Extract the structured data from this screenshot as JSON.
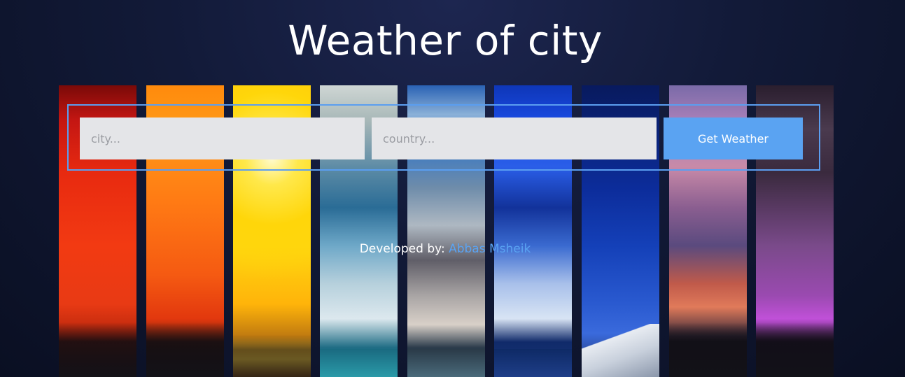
{
  "header": {
    "title": "Weather of city"
  },
  "form": {
    "city_placeholder": "city...",
    "country_placeholder": "country...",
    "submit_label": "Get Weather"
  },
  "footer": {
    "prefix": "Developed by: ",
    "author": "Abbas Msheik"
  },
  "colors": {
    "accent": "#5aa3f2",
    "border": "#5b9ef0",
    "input_bg": "#e4e5e8",
    "background": "#121a38"
  }
}
